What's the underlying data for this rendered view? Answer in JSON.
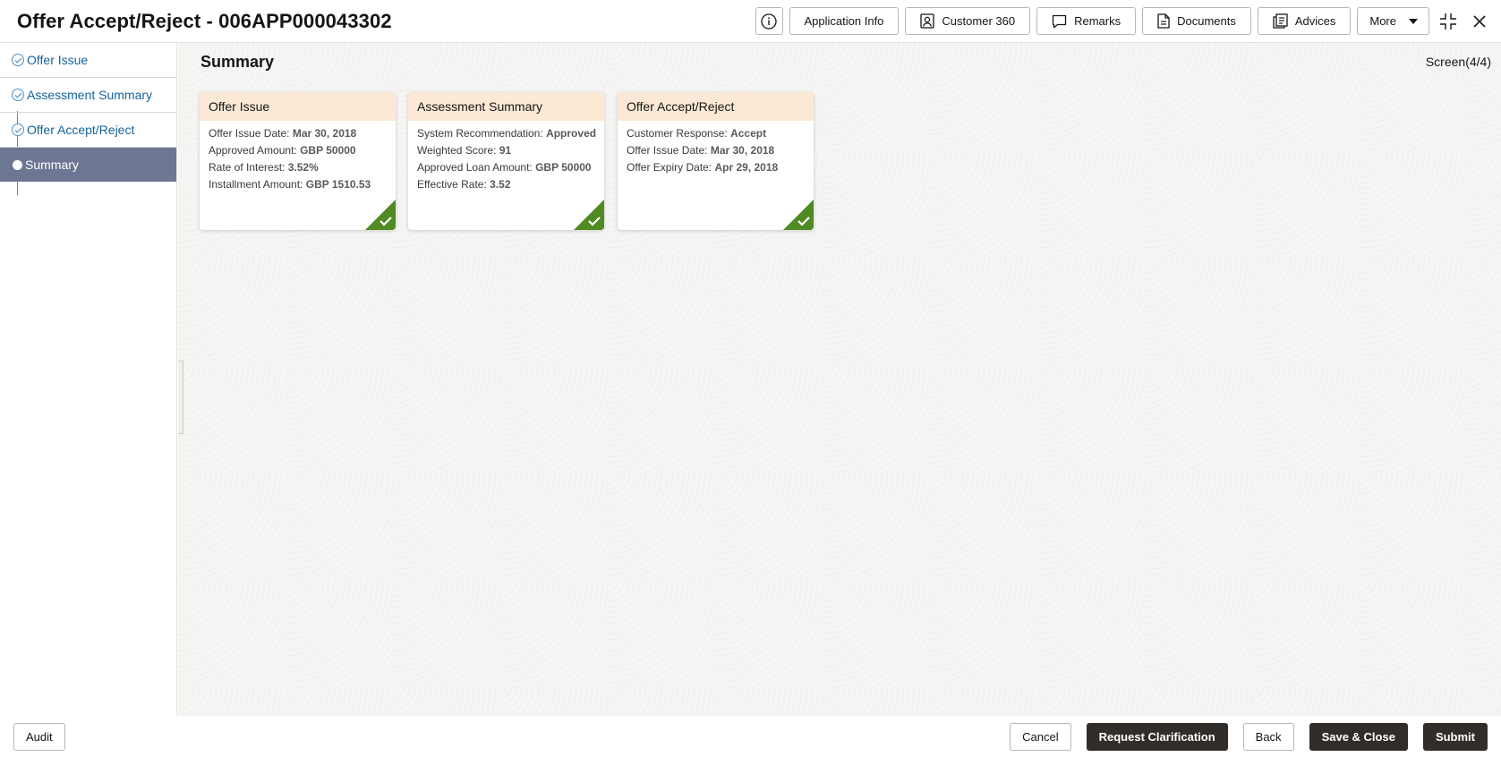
{
  "header": {
    "title": "Offer Accept/Reject - 006APP000043302",
    "buttons": {
      "application_info": "Application Info",
      "customer_360": "Customer 360",
      "remarks": "Remarks",
      "documents": "Documents",
      "advices": "Advices",
      "more": "More"
    }
  },
  "sidebar": {
    "steps": [
      {
        "label": "Offer Issue",
        "status": "completed"
      },
      {
        "label": "Assessment Summary",
        "status": "completed"
      },
      {
        "label": "Offer Accept/Reject",
        "status": "completed"
      },
      {
        "label": "Summary",
        "status": "active"
      }
    ]
  },
  "main": {
    "title": "Summary",
    "screen_count": "Screen(4/4)",
    "cards": [
      {
        "title": "Offer Issue",
        "rows": [
          {
            "label": "Offer Issue Date: ",
            "value": "Mar 30, 2018"
          },
          {
            "label": "Approved Amount: ",
            "value": "GBP 50000"
          },
          {
            "label": "Rate of Interest: ",
            "value": "3.52%"
          },
          {
            "label": "Installment Amount: ",
            "value": "GBP 1510.53"
          }
        ]
      },
      {
        "title": "Assessment Summary",
        "rows": [
          {
            "label": "System Recommendation: ",
            "value": "Approved"
          },
          {
            "label": "Weighted Score: ",
            "value": "91"
          },
          {
            "label": "Approved Loan Amount: ",
            "value": "GBP 50000"
          },
          {
            "label": "Effective Rate: ",
            "value": "3.52"
          }
        ]
      },
      {
        "title": "Offer Accept/Reject",
        "rows": [
          {
            "label": "Customer Response: ",
            "value": "Accept"
          },
          {
            "label": "Offer Issue Date: ",
            "value": "Mar 30, 2018"
          },
          {
            "label": "Offer Expiry Date: ",
            "value": "Apr 29, 2018"
          }
        ]
      }
    ]
  },
  "footer": {
    "audit": "Audit",
    "cancel": "Cancel",
    "request_clarification": "Request Clarification",
    "back": "Back",
    "save_close": "Save & Close",
    "submit": "Submit"
  },
  "colors": {
    "active_step_bg": "#6d7692",
    "step_link": "#16639a",
    "card_header_bg": "#fbe9d6",
    "check_badge": "#4f8a22",
    "dark_button": "#312d2a"
  }
}
